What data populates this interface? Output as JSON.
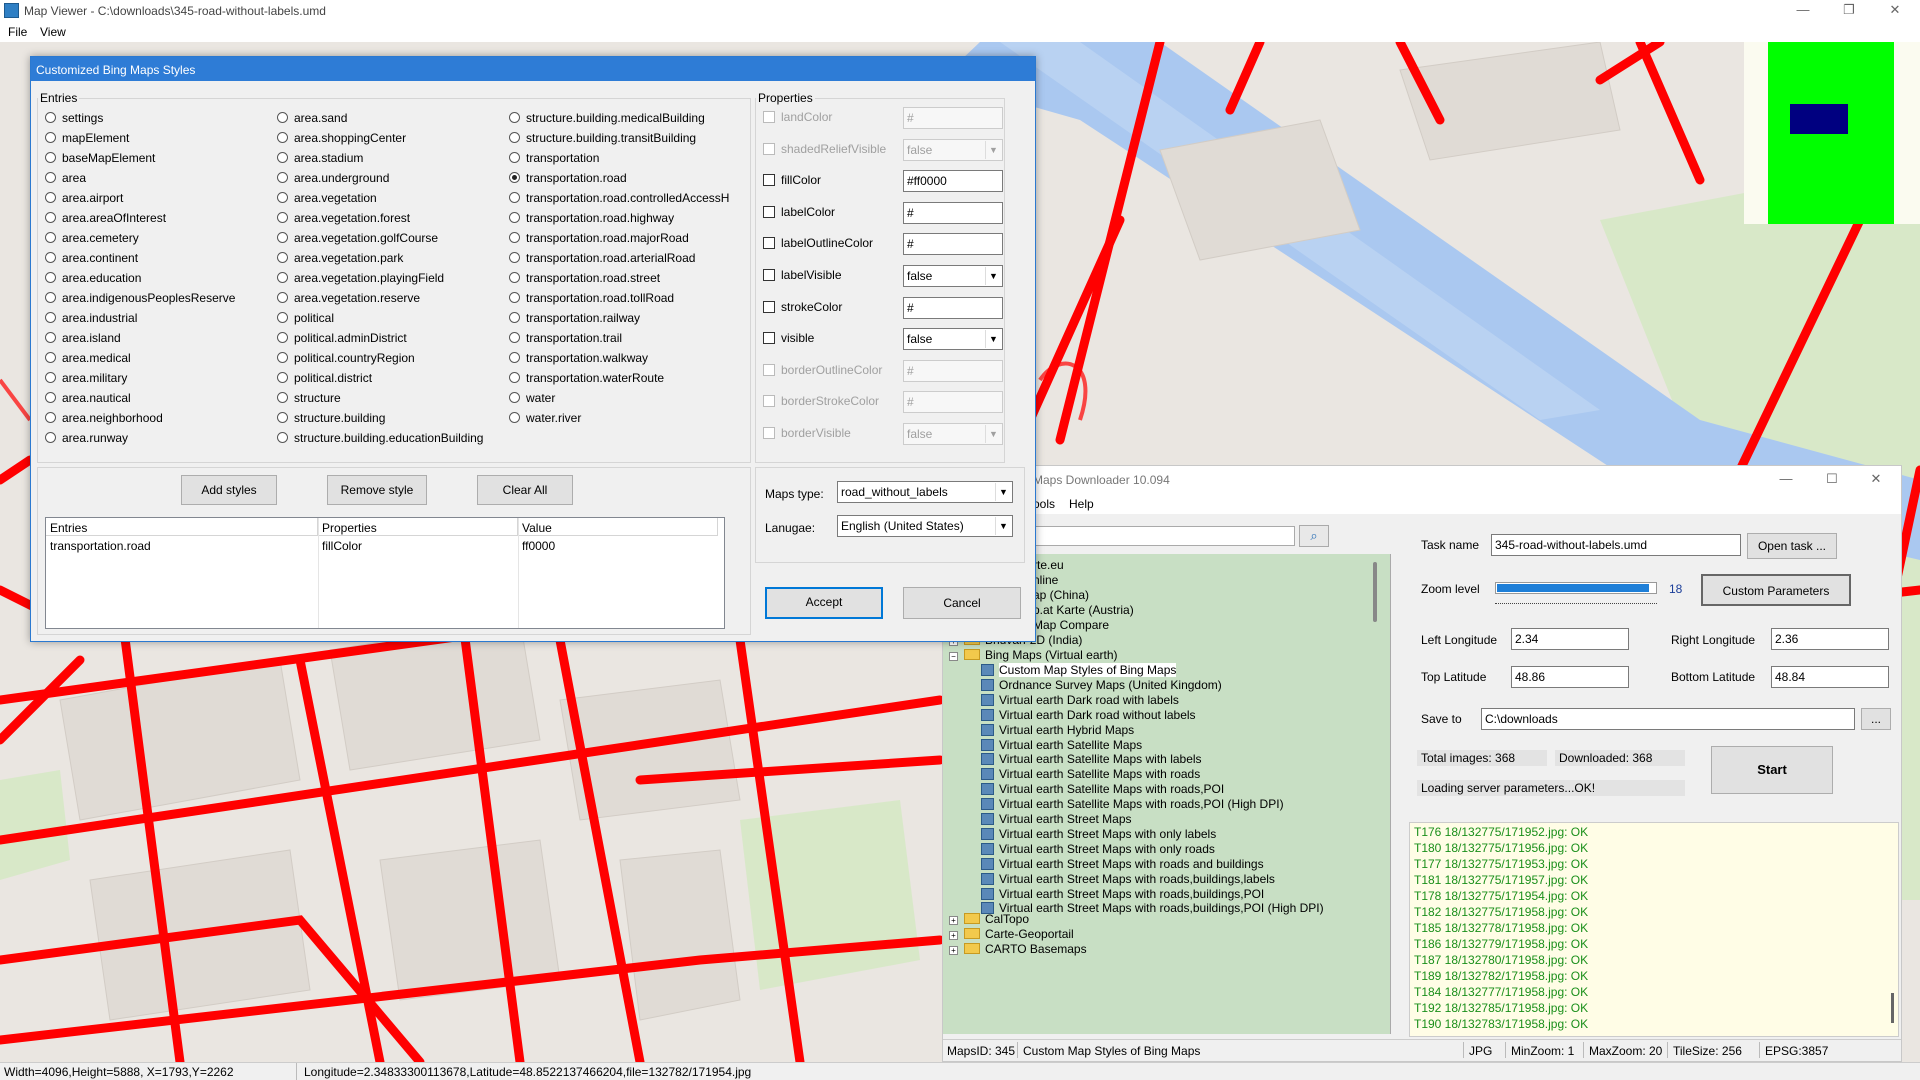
{
  "main_window": {
    "title": "Map Viewer - C:\\downloads\\345-road-without-labels.umd",
    "menu": [
      "File",
      "View"
    ],
    "controls": {
      "minimize": "—",
      "maximize": "❐",
      "close": "✕"
    }
  },
  "status_bar": {
    "left": "Width=4096,Height=5888, X=1793,Y=2262",
    "right": "Longitude=2.34833300113678,Latitude=48.8522137466204,file=132782/171954.jpg"
  },
  "minimap_colors": {
    "background": "#fbfbf0",
    "area": "#00ff00",
    "viewport": "#000080"
  },
  "map_colors": {
    "land": "#eae6e1",
    "road": "#ff0000",
    "water": "#aac8f0",
    "park": "#d8e8c8"
  },
  "dialog": {
    "title": "Customized Bing Maps Styles",
    "entries_label": "Entries",
    "entries_col1": [
      "settings",
      "mapElement",
      "baseMapElement",
      "area",
      "area.airport",
      "area.areaOfInterest",
      "area.cemetery",
      "area.continent",
      "area.education",
      "area.indigenousPeoplesReserve",
      "area.industrial",
      "area.island",
      "area.medical",
      "area.military",
      "area.nautical",
      "area.neighborhood",
      "area.runway"
    ],
    "entries_col2": [
      "area.sand",
      "area.shoppingCenter",
      "area.stadium",
      "area.underground",
      "area.vegetation",
      "area.vegetation.forest",
      "area.vegetation.golfCourse",
      "area.vegetation.park",
      "area.vegetation.playingField",
      "area.vegetation.reserve",
      "political",
      "political.adminDistrict",
      "political.countryRegion",
      "political.district",
      "structure",
      "structure.building",
      "structure.building.educationBuilding"
    ],
    "entries_col3": [
      "structure.building.medicalBuilding",
      "structure.building.transitBuilding",
      "transportation",
      "transportation.road",
      "transportation.road.controlledAccessH",
      "transportation.road.highway",
      "transportation.road.majorRoad",
      "transportation.road.arterialRoad",
      "transportation.road.street",
      "transportation.road.tollRoad",
      "transportation.railway",
      "transportation.trail",
      "transportation.walkway",
      "transportation.waterRoute",
      "water",
      "water.river"
    ],
    "selected_entry": "transportation.road",
    "properties_label": "Properties",
    "properties": [
      {
        "name": "landColor",
        "value": "#",
        "enabled": false
      },
      {
        "name": "shadedReliefVisible",
        "value": "false",
        "enabled": false
      },
      {
        "name": "fillColor",
        "value": "#ff0000",
        "enabled": true
      },
      {
        "name": "labelColor",
        "value": "#",
        "enabled": true
      },
      {
        "name": "labelOutlineColor",
        "value": "#",
        "enabled": true
      },
      {
        "name": "labelVisible",
        "value": "false",
        "enabled": true
      },
      {
        "name": "strokeColor",
        "value": "#",
        "enabled": true
      },
      {
        "name": "visible",
        "value": "false",
        "enabled": true
      },
      {
        "name": "borderOutlineColor",
        "value": "#",
        "enabled": false
      },
      {
        "name": "borderStrokeColor",
        "value": "#",
        "enabled": false
      },
      {
        "name": "borderVisible",
        "value": "false",
        "enabled": false
      }
    ],
    "buttons": {
      "add": "Add styles",
      "remove": "Remove style",
      "clear": "Clear All",
      "accept": "Accept",
      "cancel": "Cancel"
    },
    "table": {
      "headers": [
        "Entries",
        "Properties",
        "Value"
      ],
      "rows": [
        [
          "transportation.road",
          "fillColor",
          "ff0000"
        ]
      ]
    },
    "maps_type_label": "Maps type:",
    "maps_type_value": "road_without_labels",
    "language_label": "Lanugae:",
    "language_value": "English (United States)"
  },
  "downloader": {
    "title": "Maps Downloader 10.094",
    "menu": [
      "ools",
      "Help"
    ],
    "controls": {
      "minimize": "—",
      "maximize": "☐",
      "close": "✕"
    },
    "tree_partial": [
      "rte.eu",
      "nline",
      "ap (China)",
      "p.at Karte (Austria)",
      "Map Compare"
    ],
    "tree_folders_top": [
      "Bhuvan-2D (India)",
      "Bing Maps (Virtual earth)"
    ],
    "tree_bing_children": [
      "Custom Map Styles of Bing Maps",
      "Ordnance Survey Maps (United Kingdom)",
      "Virtual earth Dark road with labels",
      "Virtual earth Dark road without labels",
      "Virtual earth Hybrid Maps",
      "Virtual earth Satellite Maps",
      "Virtual earth Satellite Maps with labels",
      "Virtual earth Satellite Maps with roads",
      "Virtual earth Satellite Maps with roads,POI",
      "Virtual earth Satellite Maps with roads,POI (High DPI)",
      "Virtual earth Street Maps",
      "Virtual earth Street Maps with only labels",
      "Virtual earth Street Maps with only roads",
      "Virtual earth Street Maps with roads and buildings",
      "Virtual earth Street Maps with roads,buildings,labels",
      "Virtual earth Street Maps with roads,buildings,POI",
      "Virtual earth Street Maps with roads,buildings,POI (High DPI)"
    ],
    "tree_folders_bottom": [
      "CalTopo",
      "Carte-Geoportail",
      "CARTO Basemaps"
    ],
    "task_name_label": "Task name",
    "task_name": "345-road-without-labels.umd",
    "open_task": "Open task ...",
    "zoom_label": "Zoom level",
    "zoom_value": "18",
    "zoom_fraction": 0.95,
    "custom_params": "Custom Parameters",
    "left_lon_label": "Left Longitude",
    "left_lon": "2.34",
    "right_lon_label": "Right Longitude",
    "right_lon": "2.36",
    "top_lat_label": "Top Latitude",
    "top_lat": "48.86",
    "bottom_lat_label": "Bottom Latitude",
    "bottom_lat": "48.84",
    "save_to_label": "Save to",
    "save_to": "C:\\downloads",
    "browse": "...",
    "total_images": "Total images: 368",
    "downloaded": "Downloaded: 368",
    "status_msg": "Loading server parameters...OK!",
    "start": "Start",
    "log": [
      "T176 18/132775/171952.jpg: OK",
      "T180 18/132775/171956.jpg: OK",
      "T177 18/132775/171953.jpg: OK",
      "T181 18/132775/171957.jpg: OK",
      "T178 18/132775/171954.jpg: OK",
      "T182 18/132775/171958.jpg: OK",
      "T185 18/132778/171958.jpg: OK",
      "T186 18/132779/171958.jpg: OK",
      "T187 18/132780/171958.jpg: OK",
      "T189 18/132782/171958.jpg: OK",
      "T184 18/132777/171958.jpg: OK",
      "T192 18/132785/171958.jpg: OK",
      "T190 18/132783/171958.jpg: OK"
    ],
    "status": {
      "maps_id": "MapsID: 345",
      "map_name": "Custom Map Styles of Bing Maps",
      "format": "JPG",
      "min_zoom": "MinZoom: 1",
      "max_zoom": "MaxZoom: 20",
      "tile_size": "TileSize: 256",
      "epsg": "EPSG:3857"
    }
  }
}
